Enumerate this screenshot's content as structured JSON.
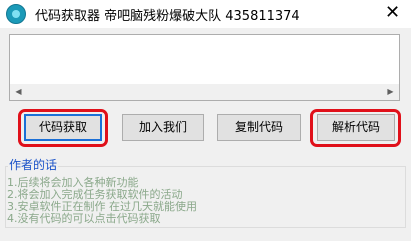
{
  "window": {
    "title": "代码获取器   帝吧脑残粉爆破大队 435811374",
    "close_glyph": "✕",
    "icon": "app-icon"
  },
  "toolbar": {
    "get_code_label": "代码获取",
    "join_us_label": "加入我们",
    "copy_code_label": "复制代码",
    "parse_code_label": "解析代码"
  },
  "author_notes": {
    "title": "作者的话",
    "lines": [
      "1.后续将会加入各种新功能",
      "2.将会加入完成任务获取软件的活动",
      "3.安卓软件正在制作 在过几天就能使用",
      "4.没有代码的可以点击代码获取"
    ]
  },
  "colors": {
    "highlight": "#e0101a",
    "group_title": "#1a52c8",
    "note_text": "#8aa88a"
  }
}
